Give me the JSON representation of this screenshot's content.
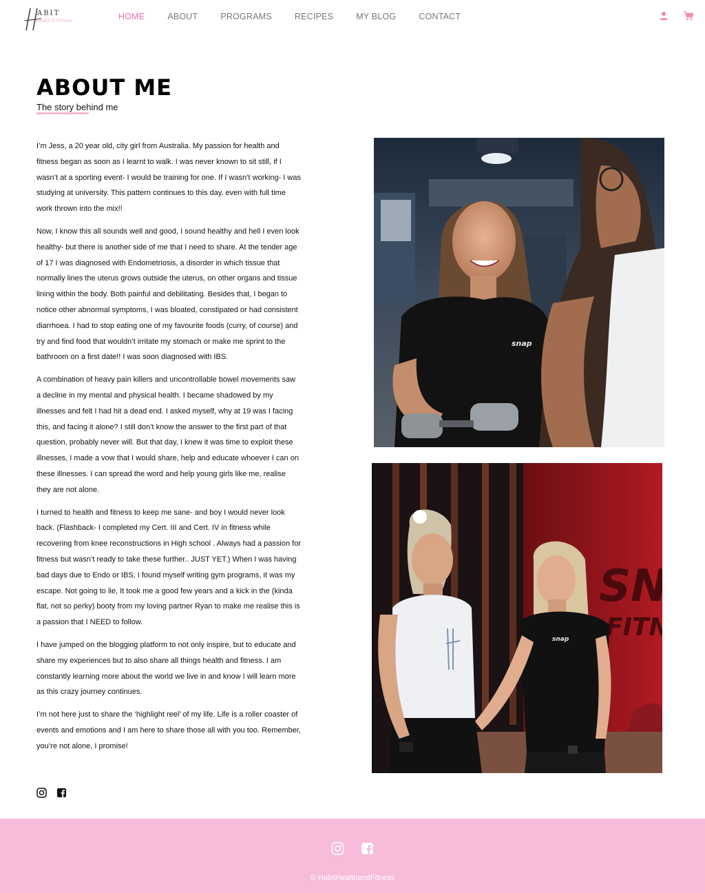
{
  "header": {
    "logo_letters": "ABIT",
    "logo_subtitle": "Health & Fitness",
    "nav": [
      {
        "label": "HOME",
        "active": true
      },
      {
        "label": "ABOUT",
        "active": false
      },
      {
        "label": "PROGRAMS",
        "active": false
      },
      {
        "label": "RECIPES",
        "active": false
      },
      {
        "label": "MY BLOG",
        "active": false
      },
      {
        "label": "CONTACT",
        "active": false
      }
    ],
    "icons": [
      "user-icon",
      "cart-icon"
    ]
  },
  "main": {
    "title": "ABOUT ME",
    "subtitle": "The story behind me",
    "paragraphs": [
      "I’m Jess, a 20 year old, city girl from Australia. My passion for health and fitness began as soon as I learnt to walk. I was never known to sit still, if I wasn’t at a sporting event- I would be training for one. If I wasn’t working- I was studying at university. This pattern continues to this day, even with full time work thrown into the mix!!",
      "Now, I know this all sounds well and good, I sound healthy and hell I even look healthy- but there is another side of me that I need to share. At the tender age of 17 I was diagnosed with Endometriosis, a disorder in which tissue that normally lines the uterus grows outside the uterus, on other organs and tissue lining within the body. Both painful and debilitating. Besides that, I began to notice other abnormal symptoms, I was bloated, constipated or  had consistent diarrhoea. I had to stop eating one of my favourite foods (curry, of course) and try and find food that wouldn’t irritate my stomach or make me sprint to the bathroom on a first date!! I was soon diagnosed with IBS.",
      "A combination of heavy pain killers and uncontrollable bowel movements saw a decline in my mental and physical health. I became shadowed by my illnesses and felt I had hit a dead end. I asked myself, why at 19 was I facing this, and facing it alone? I still don’t know the answer to the first part of that question, probably never will. But that day, I knew it was time to exploit these illnesses, I made a vow that I would share, help and educate whoever I can on these illnesses. I can spread the word and help young girls like me, realise they are not alone.",
      "I turned to health and fitness to keep me sane- and boy I would never look back. (Flashback- I completed my Cert. III and Cert. IV in fitness while recovering from knee reconstructions in High school . Always had a passion for fitness but wasn’t ready to take these further.. JUST YET.) When I was having bad days due to Endo or IBS, I found myself writing gym programs, it was my escape. Not going to lie, It took me a good few years and a kick in the (kinda flat, not so perky) booty from my loving partner Ryan to make me realise this is a passion that I NEED to follow.",
      "I have jumped on the blogging platform to not only inspire, but to educate and share my experiences but to also share all things health and fitness. I am constantly learning more about the world we live in and know I will learn more as this crazy journey continues.",
      "I’m not here just to share the ‘highlight reel’ of my life. Life is a roller coaster of events and emotions and I am here to share those all with you too. Remember, you’re not alone, I promise!"
    ],
    "social_icons": [
      "instagram-icon",
      "facebook-icon"
    ],
    "photo1_shirt_text": "snap",
    "photo2_shirt_text": "snap",
    "photo2_wall_text": "SN",
    "photo2_wall_text2": "FITNE"
  },
  "footer": {
    "copyright": "© HabitHealthandFitness",
    "background": "#f7bcd9"
  },
  "colors": {
    "accent": "#f06fb0",
    "underline": "#f7b8d4"
  }
}
